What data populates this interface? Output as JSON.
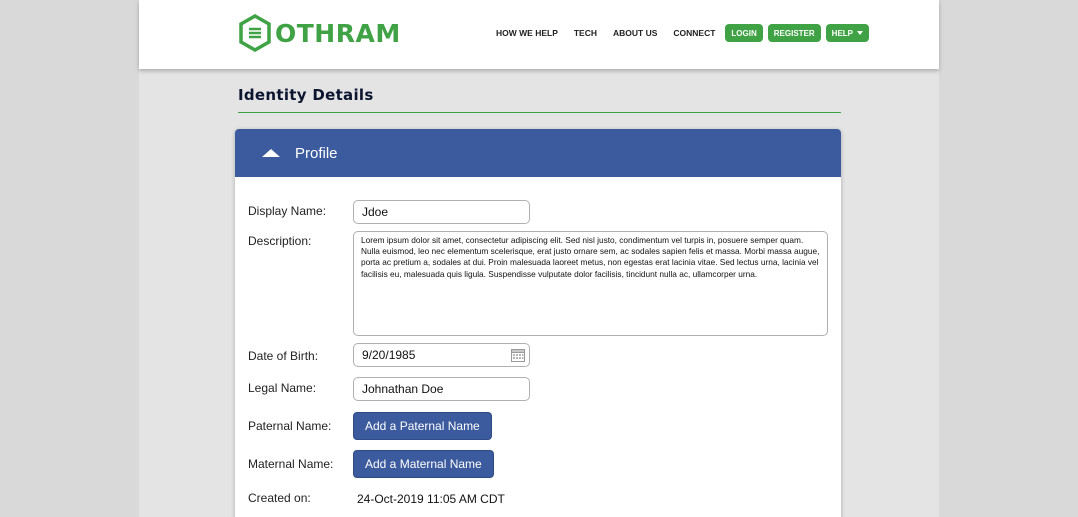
{
  "brand": {
    "name": "OTHRAM",
    "color": "#3fa244"
  },
  "nav": {
    "links": [
      "HOW WE HELP",
      "TECH",
      "ABOUT US",
      "CONNECT"
    ],
    "buttons": [
      "LOGIN",
      "REGISTER",
      "HELP"
    ]
  },
  "page": {
    "title": "Identity Details"
  },
  "profile": {
    "header": "Profile",
    "display_name_label": "Display Name:",
    "display_name": "Jdoe",
    "description_label": "Description:",
    "description": "Lorem ipsum dolor sit amet, consectetur adipiscing elit. Sed nisl justo, condimentum vel turpis in, posuere semper quam. Nulla euismod, leo nec elementum scelerisque, erat justo ornare sem, ac sodales sapien felis et massa. Morbi massa augue, porta ac pretium a, sodales at dui. Proin malesuada laoreet metus, non egestas erat lacinia vitae. Sed lectus urna, lacinia vel facilisis eu, malesuada quis ligula. Suspendisse vulputate dolor facilisis, tincidunt nulla ac, ullamcorper urna.",
    "dob_label": "Date of Birth:",
    "dob": "9/20/1985",
    "legal_name_label": "Legal Name:",
    "legal_name": "Johnathan Doe",
    "paternal_label": "Paternal Name:",
    "paternal_button": "Add a Paternal Name",
    "maternal_label": "Maternal Name:",
    "maternal_button": "Add a Maternal Name",
    "created_label": "Created on:",
    "created_on": "24-Oct-2019 11:05 AM CDT"
  },
  "icons": {
    "logo": "othram-hexagon-logo",
    "calendar": "calendar-icon",
    "collapse": "chevron-up-icon",
    "dropdown": "caret-down-icon"
  },
  "colors": {
    "header_blue": "#3b5b9e",
    "accent_green": "#3fa244"
  }
}
